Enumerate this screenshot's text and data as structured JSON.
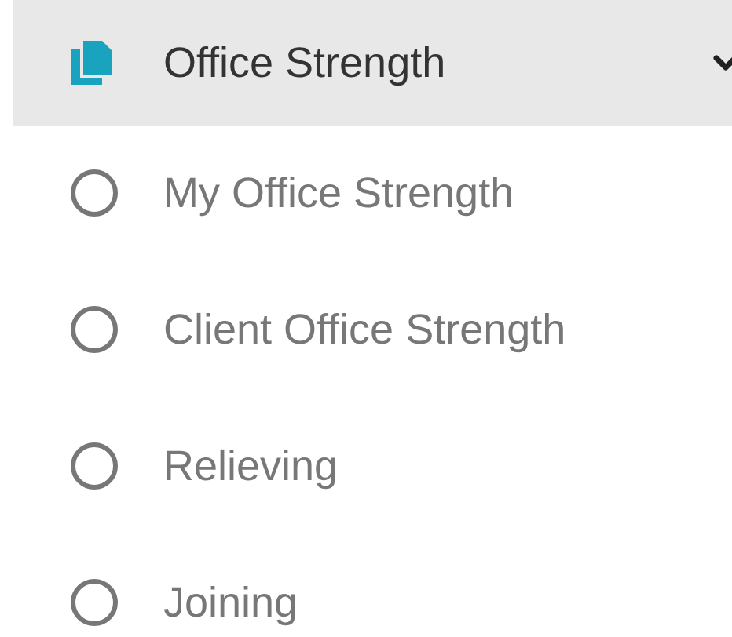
{
  "menu": {
    "label": "Office Strength",
    "expanded": true,
    "items": [
      {
        "label": "My Office Strength",
        "selected": false
      },
      {
        "label": "Client Office Strength",
        "selected": false
      },
      {
        "label": "Relieving",
        "selected": false
      },
      {
        "label": "Joining",
        "selected": false
      }
    ]
  }
}
